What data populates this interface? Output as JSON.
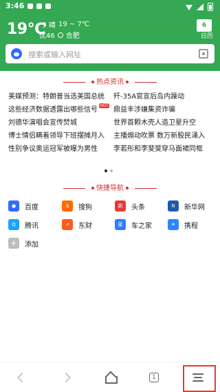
{
  "status_bar": {
    "time": "3:46"
  },
  "weather": {
    "temperature": "19℃",
    "condition": "晴",
    "range": "19 ~ 7℃",
    "aqi": "优46",
    "location": "合肥"
  },
  "calendar": {
    "day": "6",
    "label": "日历"
  },
  "search": {
    "placeholder": "搜索或输入网址"
  },
  "hot_news": {
    "title": "热点资讯",
    "rows": [
      {
        "left": "美媒预测：特朗普当选美国总统",
        "right": "歼-35A官宣后岛内躁动"
      },
      {
        "left": "这些经济数据透露出哪些信号",
        "right": "鼎益丰涉嫌集资诈骗",
        "badge": "HOT"
      },
      {
        "left": "刘德华演唱会宣传焚城",
        "right": "世界首颗木壳人造卫星升空"
      },
      {
        "left": "博士情侣瞒着领导下班摆摊月入",
        "right": "主播煽动吹票 数万新股民涌入"
      },
      {
        "left": "性别争议奥运冠军被曝为男性",
        "right": "李若彤和李斐斐穿马面裙同框"
      }
    ]
  },
  "quick_nav": {
    "title": "快捷导航",
    "items": [
      {
        "label": "百度",
        "icon": "baidu-icon",
        "color": "#2F6BFF"
      },
      {
        "label": "搜狗",
        "icon": "sogou-icon",
        "color": "#FF6A00"
      },
      {
        "label": "头条",
        "icon": "toutiao-icon",
        "color": "#E53935"
      },
      {
        "label": "新华网",
        "icon": "xinhua-icon",
        "color": "#1E5AA8"
      },
      {
        "label": "腾讯",
        "icon": "tencent-icon",
        "color": "#1AA3FF"
      },
      {
        "label": "东财",
        "icon": "dongcai-icon",
        "color": "#FF5A1F"
      },
      {
        "label": "车之家",
        "icon": "autohome-icon",
        "color": "#2E7DFF"
      },
      {
        "label": "携程",
        "icon": "ctrip-icon",
        "color": "#2E86FF"
      },
      {
        "label": "添加",
        "icon": "add-icon",
        "color": "#BDBDBD"
      }
    ]
  },
  "bottom_nav": {
    "tab_count": "1"
  },
  "colors": {
    "header_green": "#34A853",
    "accent_red": "#d32f2f"
  }
}
